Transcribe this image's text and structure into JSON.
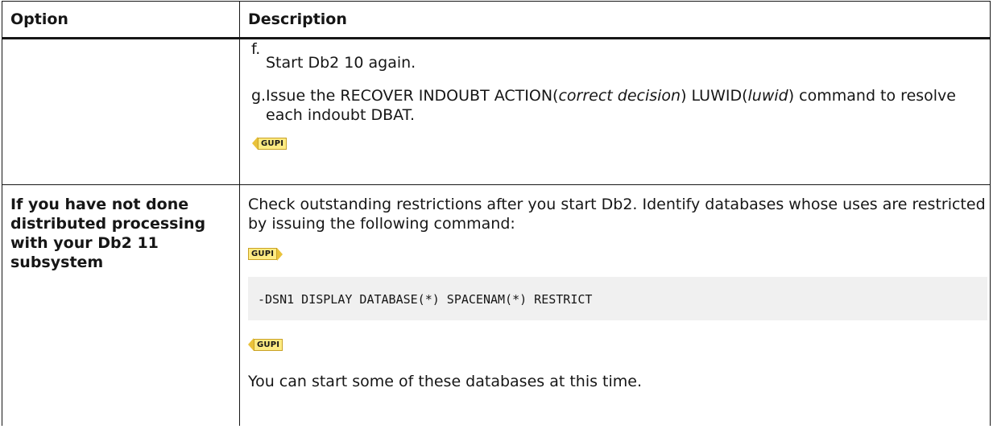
{
  "table": {
    "headers": {
      "option": "Option",
      "description": "Description"
    },
    "row1": {
      "option": "",
      "step_f": {
        "label": "f.",
        "text": "Start Db2 10 again."
      },
      "step_g": {
        "label": "g.",
        "text_1": "Issue the RECOVER INDOUBT ACTION(",
        "italic_1": "correct decision",
        "text_2": ") LUWID(",
        "italic_2": "luwid",
        "text_3": ") command to resolve each indoubt DBAT."
      },
      "gupi_end": "GUPI"
    },
    "row2": {
      "option": "If you have not done distributed processing with your Db2 11 subsystem",
      "intro": "Check outstanding restrictions after you start Db2. Identify databases whose uses are restricted by issuing the following command:",
      "gupi_start": "GUPI",
      "command": "-DSN1 DISPLAY DATABASE(*) SPACENAM(*) RESTRICT",
      "gupi_end": "GUPI",
      "closing": "You can start some of these databases at this time."
    }
  }
}
